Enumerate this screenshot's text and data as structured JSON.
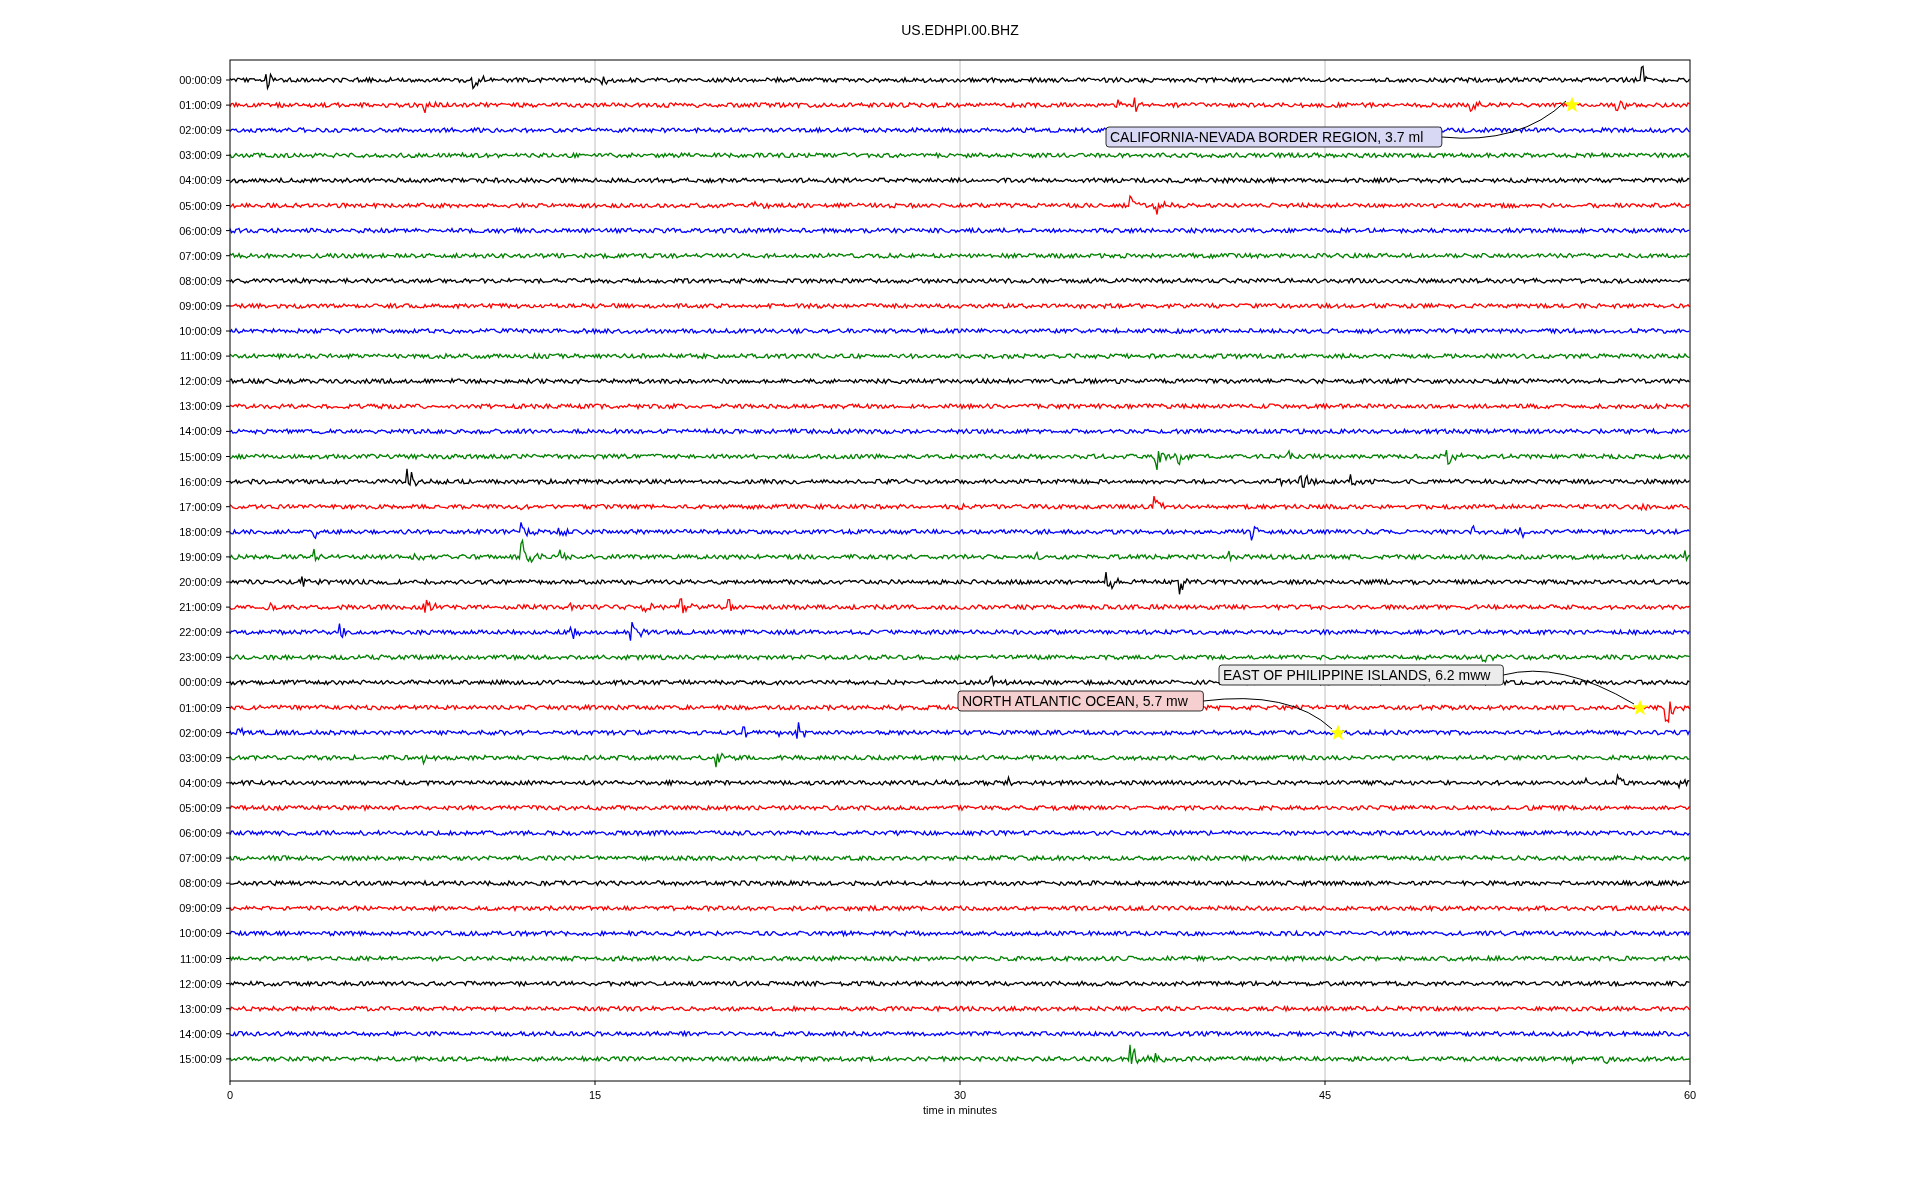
{
  "title": "US.EDHPI.00.BHZ",
  "xlabel": "time in minutes",
  "xticks": [
    "0",
    "15",
    "30",
    "45",
    "60"
  ],
  "rows": [
    {
      "label": "00:00:09",
      "color": "#000000"
    },
    {
      "label": "01:00:09",
      "color": "#ff0000"
    },
    {
      "label": "02:00:09",
      "color": "#0000ff"
    },
    {
      "label": "03:00:09",
      "color": "#008000"
    },
    {
      "label": "04:00:09",
      "color": "#000000"
    },
    {
      "label": "05:00:09",
      "color": "#ff0000"
    },
    {
      "label": "06:00:09",
      "color": "#0000ff"
    },
    {
      "label": "07:00:09",
      "color": "#008000"
    },
    {
      "label": "08:00:09",
      "color": "#000000"
    },
    {
      "label": "09:00:09",
      "color": "#ff0000"
    },
    {
      "label": "10:00:09",
      "color": "#0000ff"
    },
    {
      "label": "11:00:09",
      "color": "#008000"
    },
    {
      "label": "12:00:09",
      "color": "#000000"
    },
    {
      "label": "13:00:09",
      "color": "#ff0000"
    },
    {
      "label": "14:00:09",
      "color": "#0000ff"
    },
    {
      "label": "15:00:09",
      "color": "#008000"
    },
    {
      "label": "16:00:09",
      "color": "#000000"
    },
    {
      "label": "17:00:09",
      "color": "#ff0000"
    },
    {
      "label": "18:00:09",
      "color": "#0000ff"
    },
    {
      "label": "19:00:09",
      "color": "#008000"
    },
    {
      "label": "20:00:09",
      "color": "#000000"
    },
    {
      "label": "21:00:09",
      "color": "#ff0000"
    },
    {
      "label": "22:00:09",
      "color": "#0000ff"
    },
    {
      "label": "23:00:09",
      "color": "#008000"
    },
    {
      "label": "00:00:09",
      "color": "#000000"
    },
    {
      "label": "01:00:09",
      "color": "#ff0000"
    },
    {
      "label": "02:00:09",
      "color": "#0000ff"
    },
    {
      "label": "03:00:09",
      "color": "#008000"
    },
    {
      "label": "04:00:09",
      "color": "#000000"
    },
    {
      "label": "05:00:09",
      "color": "#ff0000"
    },
    {
      "label": "06:00:09",
      "color": "#0000ff"
    },
    {
      "label": "07:00:09",
      "color": "#008000"
    },
    {
      "label": "08:00:09",
      "color": "#000000"
    },
    {
      "label": "09:00:09",
      "color": "#ff0000"
    },
    {
      "label": "10:00:09",
      "color": "#0000ff"
    },
    {
      "label": "11:00:09",
      "color": "#008000"
    },
    {
      "label": "12:00:09",
      "color": "#000000"
    },
    {
      "label": "13:00:09",
      "color": "#ff0000"
    },
    {
      "label": "14:00:09",
      "color": "#0000ff"
    },
    {
      "label": "15:00:09",
      "color": "#008000"
    }
  ],
  "events": [
    {
      "text": "CALIFORNIA-NEVADA BORDER REGION, 3.7 ml",
      "color": "#d8d8f4"
    },
    {
      "text": "EAST OF PHILIPPINE ISLANDS, 6.2 mww",
      "color": "#ececec"
    },
    {
      "text": "NORTH ATLANTIC OCEAN, 5.7 mw",
      "color": "#f6d0d0"
    }
  ]
}
